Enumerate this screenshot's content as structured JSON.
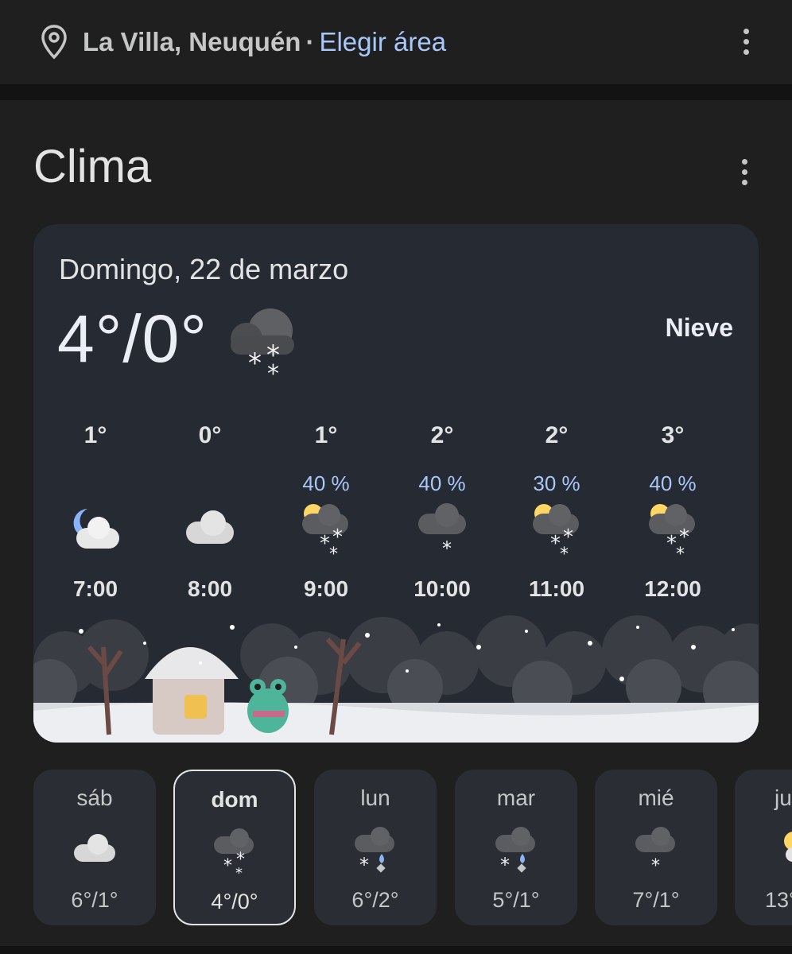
{
  "header": {
    "location": "La Villa, Neuquén",
    "separator": "·",
    "choose_area": "Elegir área"
  },
  "section": {
    "title": "Clima"
  },
  "current": {
    "date": "Domingo, 22 de marzo",
    "temp": "4°/0°",
    "condition": "Nieve",
    "icon": "cloud-snow-icon"
  },
  "hourly": [
    {
      "temp": "1°",
      "precip": "",
      "time": "7:00",
      "icon": "moon-cloud-icon"
    },
    {
      "temp": "0°",
      "precip": "",
      "time": "8:00",
      "icon": "cloud-icon"
    },
    {
      "temp": "1°",
      "precip": "40 %",
      "time": "9:00",
      "icon": "sun-cloud-snow-icon"
    },
    {
      "temp": "2°",
      "precip": "40 %",
      "time": "10:00",
      "icon": "cloud-snow-icon"
    },
    {
      "temp": "2°",
      "precip": "30 %",
      "time": "11:00",
      "icon": "sun-cloud-snow-icon"
    },
    {
      "temp": "3°",
      "precip": "40 %",
      "time": "12:00",
      "icon": "sun-cloud-snow-icon"
    }
  ],
  "daily": [
    {
      "day": "sáb",
      "temps": "6°/1°",
      "icon": "cloud-icon"
    },
    {
      "day": "dom",
      "temps": "4°/0°",
      "icon": "cloud-snow-icon"
    },
    {
      "day": "lun",
      "temps": "6°/2°",
      "icon": "cloud-snow-rain-icon"
    },
    {
      "day": "mar",
      "temps": "5°/1°",
      "icon": "cloud-snow-rain-icon"
    },
    {
      "day": "mié",
      "temps": "7°/1°",
      "icon": "cloud-snow-icon"
    },
    {
      "day": "ju",
      "temps": "13°",
      "icon": "sun-cloud-icon"
    }
  ],
  "colors": {
    "background": "#1f1f1f",
    "card": "#262a33",
    "accent_link": "#a8c7fa",
    "precip": "#a8c7fa"
  }
}
